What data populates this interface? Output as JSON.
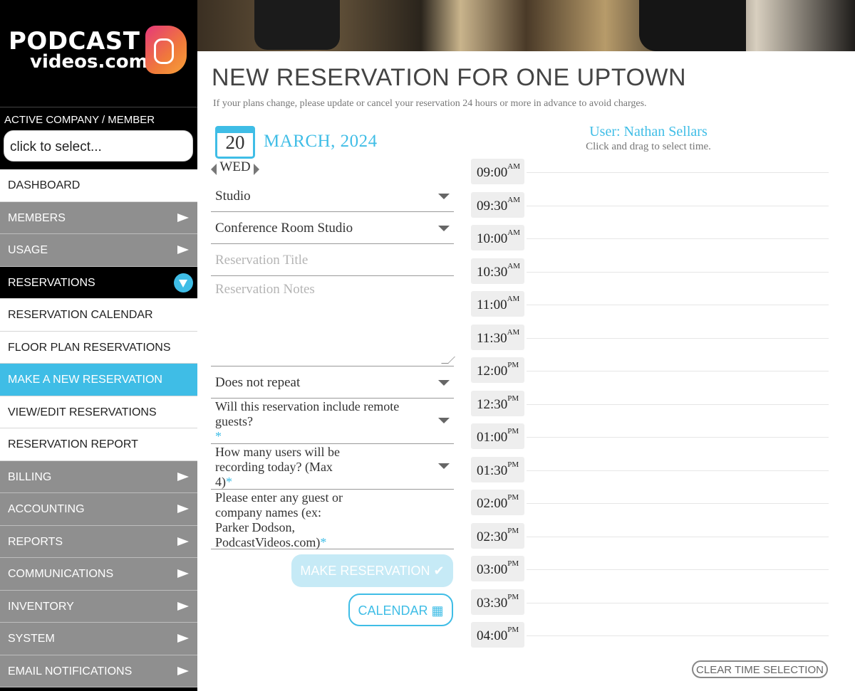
{
  "brand": {
    "line1": "PODCAST",
    "line2": "videos.com"
  },
  "sidebar": {
    "active_label": "ACTIVE COMPANY / MEMBER",
    "company_select": "click to select...",
    "items": [
      {
        "label": "DASHBOARD",
        "style": "white",
        "icon": ""
      },
      {
        "label": "MEMBERS",
        "style": "gray",
        "icon": "chevron-right-icon"
      },
      {
        "label": "USAGE",
        "style": "gray",
        "icon": "chevron-right-icon"
      },
      {
        "label": "RESERVATIONS",
        "style": "black",
        "icon": "chevron-down-circle-icon"
      },
      {
        "label": "RESERVATION CALENDAR",
        "style": "white",
        "icon": ""
      },
      {
        "label": "FLOOR PLAN RESERVATIONS",
        "style": "white",
        "icon": ""
      },
      {
        "label": "MAKE A NEW RESERVATION",
        "style": "blue",
        "icon": ""
      },
      {
        "label": "VIEW/EDIT RESERVATIONS",
        "style": "white",
        "icon": ""
      },
      {
        "label": "RESERVATION REPORT",
        "style": "white",
        "icon": ""
      },
      {
        "label": "BILLING",
        "style": "gray",
        "icon": "chevron-right-icon"
      },
      {
        "label": "ACCOUNTING",
        "style": "gray",
        "icon": "chevron-right-icon"
      },
      {
        "label": "REPORTS",
        "style": "gray",
        "icon": "chevron-right-icon"
      },
      {
        "label": "COMMUNICATIONS",
        "style": "gray",
        "icon": "chevron-right-icon"
      },
      {
        "label": "INVENTORY",
        "style": "gray",
        "icon": "chevron-right-icon"
      },
      {
        "label": "SYSTEM",
        "style": "gray",
        "icon": "chevron-right-icon"
      },
      {
        "label": "EMAIL NOTIFICATIONS",
        "style": "gray",
        "icon": "chevron-right-icon"
      }
    ]
  },
  "page": {
    "title": "NEW RESERVATION FOR ONE UPTOWN",
    "subtitle": "If your plans change, please update or cancel your reservation 24 hours or more in advance to avoid charges."
  },
  "date": {
    "day": "20",
    "month_year": "MARCH, 2024",
    "weekday": "WED"
  },
  "form": {
    "resource_type": "Studio",
    "resource": "Conference Room Studio",
    "title_placeholder": "Reservation Title",
    "notes_placeholder": "Reservation Notes",
    "repeat": "Does not repeat",
    "remote_guests_q": "Will this reservation include remote guests?",
    "recording_users_q": "How many users will be recording today? (Max 4)",
    "guest_names_q": "Please enter any guest or company names (ex: Parker Dodson, PodcastVideos.com)",
    "required_mark": "*"
  },
  "buttons": {
    "make_reservation": "MAKE RESERVATION",
    "calendar": "CALENDAR",
    "clear_time": "CLEAR TIME SELECTION"
  },
  "schedule": {
    "user": "User: Nathan Sellars",
    "hint": "Click and drag to select time.",
    "slots": [
      {
        "time": "09:00",
        "ampm": "AM"
      },
      {
        "time": "09:30",
        "ampm": "AM"
      },
      {
        "time": "10:00",
        "ampm": "AM"
      },
      {
        "time": "10:30",
        "ampm": "AM"
      },
      {
        "time": "11:00",
        "ampm": "AM"
      },
      {
        "time": "11:30",
        "ampm": "AM"
      },
      {
        "time": "12:00",
        "ampm": "PM"
      },
      {
        "time": "12:30",
        "ampm": "PM"
      },
      {
        "time": "01:00",
        "ampm": "PM"
      },
      {
        "time": "01:30",
        "ampm": "PM"
      },
      {
        "time": "02:00",
        "ampm": "PM"
      },
      {
        "time": "02:30",
        "ampm": "PM"
      },
      {
        "time": "03:00",
        "ampm": "PM"
      },
      {
        "time": "03:30",
        "ampm": "PM"
      },
      {
        "time": "04:00",
        "ampm": "PM"
      }
    ]
  },
  "colors": {
    "accent": "#3fbde6",
    "sidebar_gray": "#8f8f8f",
    "sidebar_black": "#000000"
  }
}
